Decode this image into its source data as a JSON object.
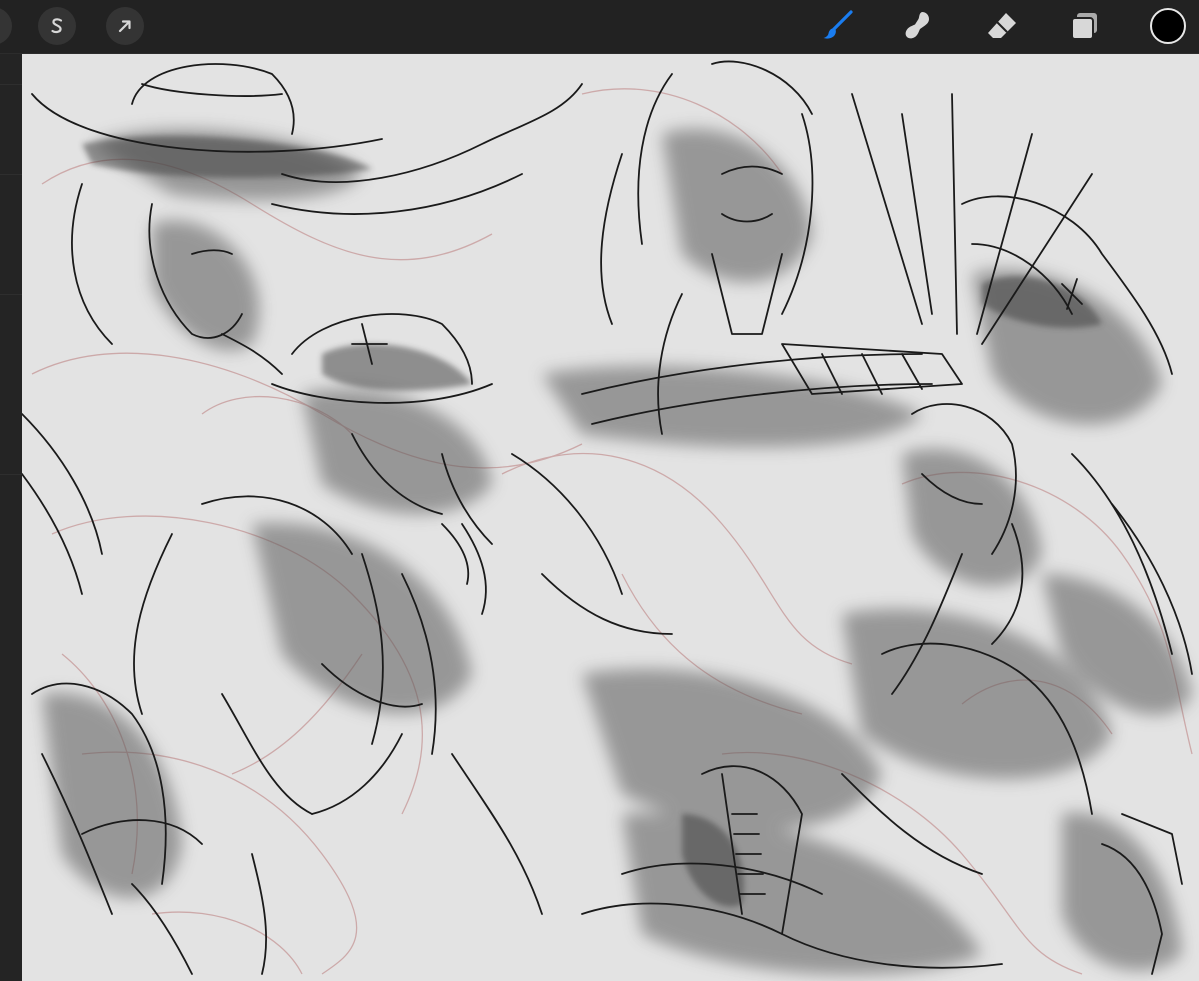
{
  "app": {
    "name": "drawing-app"
  },
  "toolbar": {
    "left_tools": [
      {
        "name": "selection-tool",
        "icon": "selection-s-icon"
      },
      {
        "name": "transform-tool",
        "icon": "arrow-cursor-icon"
      }
    ],
    "right_tools": [
      {
        "name": "brush-tool",
        "icon": "brush-icon",
        "active": true
      },
      {
        "name": "smudge-tool",
        "icon": "smudge-finger-icon",
        "active": false
      },
      {
        "name": "eraser-tool",
        "icon": "eraser-icon",
        "active": false
      },
      {
        "name": "layers-button",
        "icon": "layers-icon",
        "active": false
      },
      {
        "name": "color-swatch",
        "icon": "color-circle-icon",
        "active": false
      }
    ],
    "colors": {
      "bar": "#222222",
      "icon": "#d8d8d8",
      "active": "#1a7df0",
      "current_color": "#000000"
    }
  },
  "canvas": {
    "background": "#e3e3e3",
    "content": "sketch-artwork",
    "colors": {
      "line": "#1a1a1a",
      "shade": "#5a5a5a",
      "rough": "#c9a0a0"
    }
  }
}
